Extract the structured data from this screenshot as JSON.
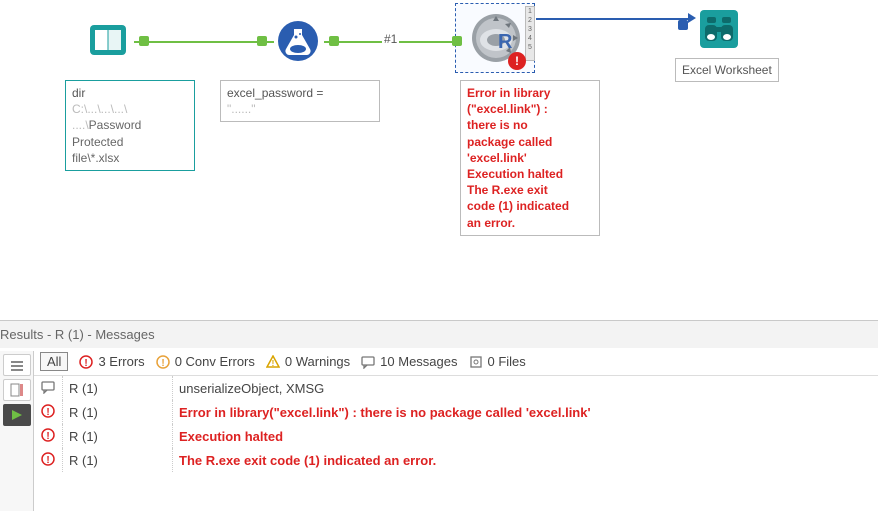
{
  "canvas": {
    "node1": {
      "label_lines": [
        "dir",
        "C:\\...\\...\\...\\",
        "...\\Password",
        "Protected",
        "file\\*.xlsx"
      ]
    },
    "node2": {
      "label_lines": [
        "excel_password =",
        "\"......\""
      ]
    },
    "node3": {
      "error_lines": [
        "Error in library",
        "(\"excel.link\") :",
        "there is no",
        "package called",
        "'excel.link'",
        "Execution halted",
        "The R.exe exit",
        "code (1) indicated",
        "an error."
      ]
    },
    "node4": {
      "label": "Excel Worksheet"
    },
    "conn_label": "#1",
    "anchor_numbers": [
      "1",
      "2",
      "3",
      "4",
      "5"
    ]
  },
  "results": {
    "title": "Results - R (1) - Messages",
    "filters": {
      "all": "All",
      "errors": "3 Errors",
      "conv": "0 Conv Errors",
      "warnings": "0 Warnings",
      "messages": "10 Messages",
      "files": "0 Files"
    },
    "rows": [
      {
        "icon": "msg",
        "src": "R (1)",
        "text": "unserializeObject, XMSG",
        "err": false
      },
      {
        "icon": "error",
        "src": "R (1)",
        "text": "Error in library(\"excel.link\") : there is no package called 'excel.link'",
        "err": true
      },
      {
        "icon": "error",
        "src": "R (1)",
        "text": "Execution halted",
        "err": true
      },
      {
        "icon": "error",
        "src": "R (1)",
        "text": "The R.exe exit code (1) indicated an error.",
        "err": true
      }
    ]
  },
  "colors": {
    "teal": "#1a9e9e",
    "green": "#6fbf44",
    "blue": "#2a5db0",
    "errorRed": "#d22222"
  }
}
